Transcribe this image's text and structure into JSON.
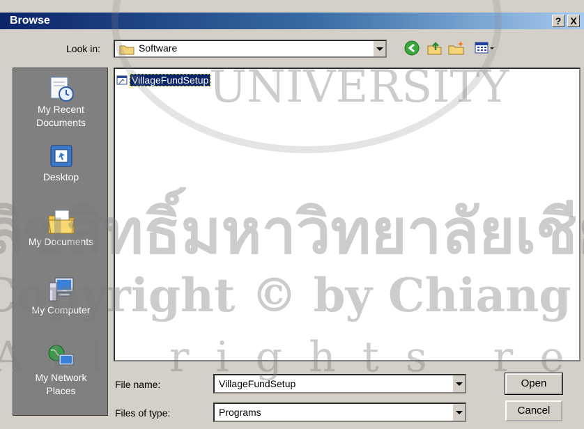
{
  "window": {
    "title": "Browse",
    "help_label": "?",
    "close_label": "X"
  },
  "toolbar": {
    "look_in_label": "Look in:",
    "look_in_value": "Software",
    "icons": [
      "folder-icon",
      "back-icon",
      "up-folder-icon",
      "new-folder-icon",
      "view-menu-icon"
    ]
  },
  "places": [
    {
      "label_line1": "My Recent",
      "label_line2": "Documents",
      "icon": "recent-documents-icon"
    },
    {
      "label_line1": "Desktop",
      "label_line2": "",
      "icon": "desktop-icon"
    },
    {
      "label_line1": "My Documents",
      "label_line2": "",
      "icon": "my-documents-icon"
    },
    {
      "label_line1": "My Computer",
      "label_line2": "",
      "icon": "my-computer-icon"
    },
    {
      "label_line1": "My Network",
      "label_line2": "Places",
      "icon": "network-places-icon"
    }
  ],
  "files": [
    {
      "name": "VillageFundSetup",
      "selected": true
    }
  ],
  "form": {
    "file_name_label": "File name:",
    "file_name_value": "VillageFundSetup",
    "file_type_label": "Files of type:",
    "file_type_value": "Programs"
  },
  "buttons": {
    "open": "Open",
    "cancel": "Cancel"
  },
  "watermark": {
    "line1": "UNIVERSITY",
    "line2": "ลิขสิทธิ์มหาวิทยาลัยเชียงใหม่",
    "line3": "Copyright © by Chiang Mai University",
    "line4": "All rights reserved"
  },
  "colors": {
    "title_start": "#0a246a",
    "title_end": "#a6caf0",
    "selection": "#0a246a",
    "places_bg": "#808080"
  }
}
